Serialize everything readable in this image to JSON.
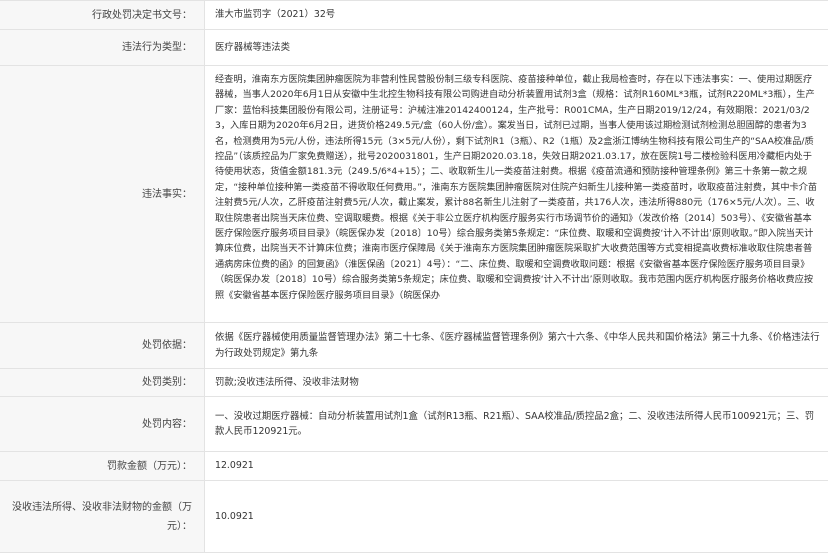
{
  "rows": [
    {
      "key": "doc_no",
      "label": "行政处罚决定书文号：",
      "value": "淮大市监罚字（2021）32号"
    },
    {
      "key": "violation_type",
      "label": "违法行为类型：",
      "value": "医疗器械等违法类"
    },
    {
      "key": "facts",
      "label": "违法事实：",
      "value": "经查明，淮南东方医院集团肿瘤医院为非营利性民营股份制三级专科医院、疫苗接种单位，截止我局检查时，存在以下违法事实：一、使用过期医疗器械，当事人2020年6月1日从安徽中生北控生物科技有限公司购进自动分析装置用试剂3盒（规格：试剂R160ML*3瓶，试剂R220ML*3瓶），生产厂家：蓝怡科技集团股份有限公司，注册证号：沪械注准20142400124，生产批号：R001CMA，生产日期2019/12/24，有效期限：2021/03/23，入库日期为2020年6月2日，进货价格249.5元/盒（60人份/盒）。案发当日，试剂已过期，当事人使用该过期检测试剂检测总胆固醇的患者为3名，检测费用为5元/人份，违法所得15元（3×5元/人份），剩下试剂R1（3瓶）、R2（1瓶）及2盒浙江博纳生物科技有限公司生产的“SAA校准品/质控品”（该质控品为厂家免费赠送），批号2020031801，生产日期2020.03.18，失效日期2021.03.17，放在医院1号二楼检验科医用冷藏柜内处于待使用状态，货值金额181.3元（249.5/6*4+15）；二、收取新生儿一类疫苗注射费。根据《疫苗流通和预防接种管理条例》第三十条第一款之规定，“接种单位接种第一类疫苗不得收取任何费用。”，淮南东方医院集团肿瘤医院对住院产妇新生儿接种第一类疫苗时，收取疫苗注射费，其中卡介苗注射费5元/人次，乙肝疫苗注射费5元/人次，截止案发，累计88名新生儿注射了一类疫苗，共176人次，违法所得880元（176×5元/人次）。三、收取住院患者出院当天床位费、空调取暖费。根据《关于非公立医疗机构医疗服务实行市场调节价的通知》（发改价格〔2014〕503号）、《安徽省基本医疗保险医疗服务项目目录》（皖医保办发〔2018〕10号）综合服务类第5条规定：“床位费、取暖和空调费按‘计入不计出’原则收取。”即入院当天计算床位费，出院当天不计算床位费；淮南市医疗保障局《关于淮南东方医院集团肿瘤医院采取扩大收费范围等方式变相提高收费标准收取住院患者普通病房床位费的函》的回复函》（淮医保函〔2021〕4号）：“二、床位费、取暖和空调费收取问题：根据《安徽省基本医疗保险医疗服务项目目录》（皖医保办发〔2018〕10号）综合服务类第5条规定；床位费、取暖和空调费按‘计入不计出’原则收取。我市范围内医疗机构医疗服务价格收费应按照《安徽省基本医疗保险医疗服务项目目录》（皖医保办"
    },
    {
      "key": "basis",
      "label": "处罚依据：",
      "value": "依据《医疗器械使用质量监督管理办法》第二十七条、《医疗器械监督管理条例》第六十六条、《中华人民共和国价格法》第三十九条、《价格违法行为行政处罚规定》第九条"
    },
    {
      "key": "category",
      "label": "处罚类别：",
      "value": "罚款;没收违法所得、没收非法财物"
    },
    {
      "key": "content",
      "label": "处罚内容：",
      "value": "一、没收过期医疗器械：自动分析装置用试剂1盒（试剂R13瓶、R21瓶）、SAA校准品/质控品2盒；二、没收违法所得人民币100921元；三、罚款人民币120921元。"
    },
    {
      "key": "fine",
      "label": "罚款金额（万元）：",
      "value": "12.0921"
    },
    {
      "key": "confiscation",
      "label": "没收违法所得、没收非法财物的金额（万元）：",
      "value": "10.0921"
    }
  ]
}
